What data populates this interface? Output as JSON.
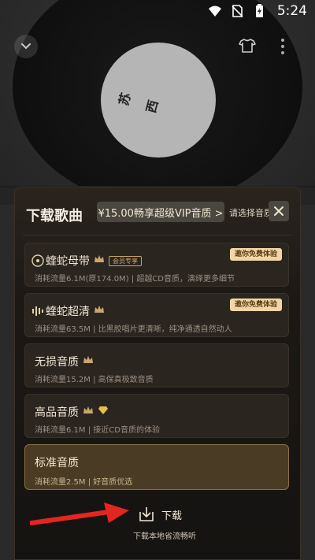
{
  "status_bar": {
    "time": "5:24",
    "icons": [
      "wifi-icon",
      "no-sim-icon",
      "battery-charging-icon"
    ]
  },
  "player": {
    "cover_text": "苏西",
    "top_icons": [
      "chevron-down-icon",
      "shirt-icon",
      "more-icon"
    ]
  },
  "sheet": {
    "title": "下载歌曲",
    "vip_pill": "¥15.00畅享超级VIP音质 >",
    "choose_label": "请选择音质",
    "close_icon": "close-icon",
    "options": [
      {
        "title": "蝰蛇母带",
        "tag": "会员专享",
        "desc": "消耗流量6.1M(原174.0M) | 超越CD音质，演绎更多细节",
        "badge": "邀你免费体验",
        "selected": false
      },
      {
        "title": "蝰蛇超清",
        "desc": "消耗流量63.5M | 比黑胶唱片更清晰，纯净通透自然动人",
        "badge": "邀你免费体验",
        "selected": false
      },
      {
        "title": "无损音质",
        "desc": "消耗流量15.2M | 高保真极致音质",
        "selected": false
      },
      {
        "title": "高品音质",
        "desc": "消耗流量6.1M | 接近CD音质的体验",
        "selected": false
      },
      {
        "title": "标准音质",
        "desc": "消耗流量2.5M | 好音质优选",
        "selected": true
      }
    ],
    "download_label": "下载",
    "download_sub": "下载本地省流畅听"
  },
  "colors": {
    "accent_gold": "#c9a66b",
    "selected_bg": "#4a3b24",
    "arrow_red": "#e3261f"
  }
}
